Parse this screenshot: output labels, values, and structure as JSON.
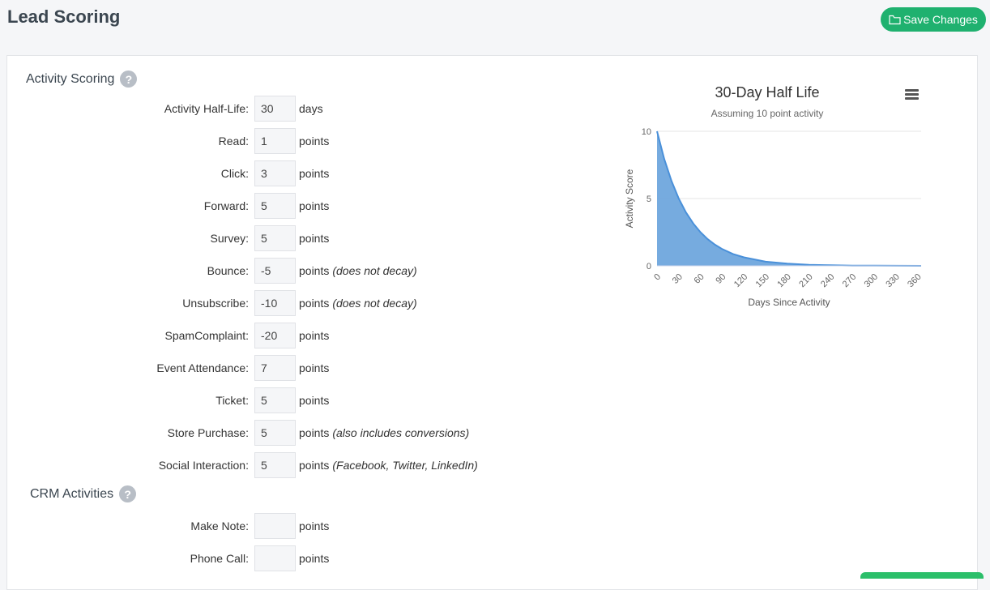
{
  "header": {
    "title": "Lead Scoring",
    "save_label": "Save Changes"
  },
  "activity_section": {
    "title": "Activity Scoring",
    "help": "?",
    "rows": [
      {
        "label": "Activity Half-Life:",
        "value": "30",
        "unit": "days",
        "note": ""
      },
      {
        "label": "Read:",
        "value": "1",
        "unit": "points",
        "note": ""
      },
      {
        "label": "Click:",
        "value": "3",
        "unit": "points",
        "note": ""
      },
      {
        "label": "Forward:",
        "value": "5",
        "unit": "points",
        "note": ""
      },
      {
        "label": "Survey:",
        "value": "5",
        "unit": "points",
        "note": ""
      },
      {
        "label": "Bounce:",
        "value": "-5",
        "unit": "points",
        "note": "(does not decay)"
      },
      {
        "label": "Unsubscribe:",
        "value": "-10",
        "unit": "points",
        "note": "(does not decay)"
      },
      {
        "label": "SpamComplaint:",
        "value": "-20",
        "unit": "points",
        "note": ""
      },
      {
        "label": "Event Attendance:",
        "value": "7",
        "unit": "points",
        "note": ""
      },
      {
        "label": "Ticket:",
        "value": "5",
        "unit": "points",
        "note": ""
      },
      {
        "label": "Store Purchase:",
        "value": "5",
        "unit": "points",
        "note": "(also includes conversions)"
      },
      {
        "label": "Social Interaction:",
        "value": "5",
        "unit": "points",
        "note": "(Facebook, Twitter, LinkedIn)"
      }
    ]
  },
  "crm_section": {
    "title": "CRM Activities",
    "help": "?",
    "rows": [
      {
        "label": "Make Note:",
        "value": "",
        "unit": "points",
        "note": ""
      },
      {
        "label": "Phone Call:",
        "value": "",
        "unit": "points",
        "note": ""
      }
    ]
  },
  "chart_data": {
    "type": "area",
    "title": "30-Day Half Life",
    "subtitle": "Assuming 10 point activity",
    "xlabel": "Days Since Activity",
    "ylabel": "Activity Score",
    "xlim": [
      0,
      365
    ],
    "ylim": [
      0,
      10
    ],
    "x_ticks": [
      "0",
      "30",
      "60",
      "90",
      "120",
      "150",
      "180",
      "210",
      "240",
      "270",
      "300",
      "330",
      "360"
    ],
    "y_ticks": [
      "0",
      "5",
      "10"
    ],
    "series": [
      {
        "x": [
          0,
          10,
          20,
          30,
          40,
          50,
          60,
          70,
          80,
          90,
          105,
          120,
          150,
          180,
          210,
          240,
          270,
          300,
          330,
          365
        ],
        "values": [
          10,
          7.94,
          6.3,
          5,
          3.97,
          3.15,
          2.5,
          1.98,
          1.57,
          1.25,
          0.88,
          0.63,
          0.31,
          0.16,
          0.08,
          0.04,
          0.02,
          0.01,
          0.005,
          0.002
        ]
      }
    ],
    "color": "#4a90d9",
    "fill": "#6fa6dd",
    "grid": true
  }
}
